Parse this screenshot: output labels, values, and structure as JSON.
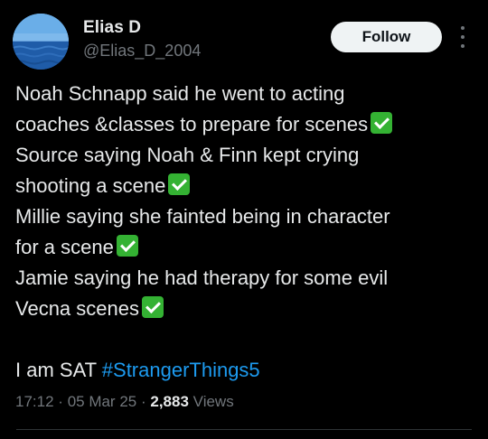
{
  "author": {
    "name": "Elias D",
    "handle": "@Elias_D_2004",
    "avatar_icon": "ocean-horizon-avatar"
  },
  "follow_label": "Follow",
  "more_icon": "more-vertical-icon",
  "tweet": {
    "lines": [
      "Noah Schnapp said he went to acting",
      "coaches &classes to prepare for scenes",
      "Source saying Noah & Finn kept crying",
      "shooting a scene",
      "Millie saying she fainted being in character",
      "for a scene",
      "Jamie saying he had therapy for some evil",
      "Vecna scenes"
    ],
    "check_icon": "check-mark-button-emoji",
    "closing_text": "I am SAT",
    "hashtag": "#StrangerThings5"
  },
  "meta": {
    "time": "17:12",
    "separator": "·",
    "date": "05 Mar 25",
    "views_count": "2,883",
    "views_label": "Views"
  },
  "colors": {
    "background": "#000000",
    "text": "#e7e9ea",
    "muted": "#71767b",
    "link": "#1d9bf0",
    "check": "#34b233"
  }
}
